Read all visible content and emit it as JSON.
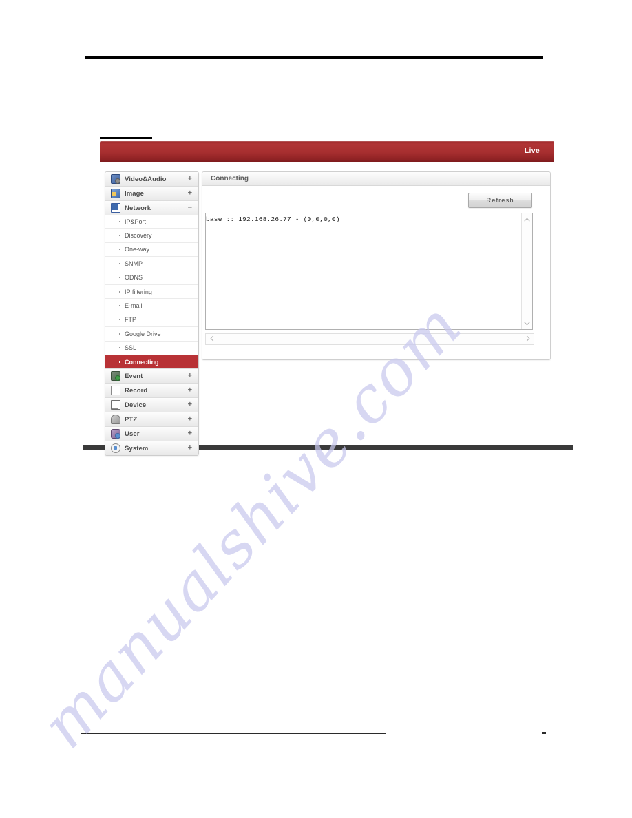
{
  "topbar": {
    "live_label": "Live"
  },
  "sidebar": {
    "groups": [
      {
        "label": "Video&Audio",
        "icon": "video-audio-icon",
        "sign": "+",
        "expanded": false,
        "items": []
      },
      {
        "label": "Image",
        "icon": "image-icon",
        "sign": "+",
        "expanded": false,
        "items": []
      },
      {
        "label": "Network",
        "icon": "network-icon",
        "sign": "−",
        "expanded": true,
        "items": [
          {
            "label": "IP&Port",
            "selected": false
          },
          {
            "label": "Discovery",
            "selected": false
          },
          {
            "label": "One-way",
            "selected": false
          },
          {
            "label": "SNMP",
            "selected": false
          },
          {
            "label": "ODNS",
            "selected": false
          },
          {
            "label": "IP filtering",
            "selected": false
          },
          {
            "label": "E-mail",
            "selected": false
          },
          {
            "label": "FTP",
            "selected": false
          },
          {
            "label": "Google Drive",
            "selected": false
          },
          {
            "label": "SSL",
            "selected": false
          },
          {
            "label": "Connecting",
            "selected": true
          }
        ]
      },
      {
        "label": "Event",
        "icon": "event-icon",
        "sign": "+",
        "expanded": false,
        "items": []
      },
      {
        "label": "Record",
        "icon": "record-icon",
        "sign": "+",
        "expanded": false,
        "items": []
      },
      {
        "label": "Device",
        "icon": "device-icon",
        "sign": "+",
        "expanded": false,
        "items": []
      },
      {
        "label": "PTZ",
        "icon": "ptz-icon",
        "sign": "+",
        "expanded": false,
        "items": []
      },
      {
        "label": "User",
        "icon": "user-icon",
        "sign": "+",
        "expanded": false,
        "items": []
      },
      {
        "label": "System",
        "icon": "system-icon",
        "sign": "+",
        "expanded": false,
        "items": []
      }
    ]
  },
  "panel": {
    "title": "Connecting",
    "refresh_label": "Refresh",
    "console_text": "base :: 192.168.26.77 - (0,0,0,0)"
  },
  "watermark": {
    "text": "manualshive.com"
  },
  "colors": {
    "accent_red": "#b83236",
    "topbar_red": "#a82f30",
    "watermark": "#c9c9ee",
    "rule_black": "#000000"
  }
}
